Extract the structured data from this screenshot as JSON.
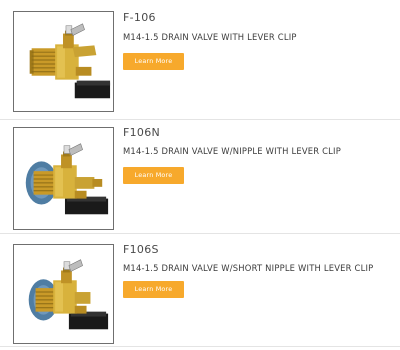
{
  "products": [
    {
      "sku": "F-106",
      "description": "M14-1.5 DRAIN VALVE WITH LEVER CLIP",
      "button_label": "Learn More",
      "image_icon": "drain-valve-lever-clip-image"
    },
    {
      "sku": "F106N",
      "description": "M14-1.5 DRAIN VALVE W/NIPPLE WITH LEVER CLIP",
      "button_label": "Learn More",
      "image_icon": "drain-valve-nipple-image"
    },
    {
      "sku": "F106S",
      "description": "M14-1.5 DRAIN VALVE W/SHORT NIPPLE WITH LEVER CLIP",
      "button_label": "Learn More",
      "image_icon": "drain-valve-short-nipple-image"
    }
  ],
  "colors": {
    "button": "#f7a92c",
    "brass": "#c9a233",
    "seal_ring": "#4f7da3",
    "lever": "#1e1e1e"
  }
}
